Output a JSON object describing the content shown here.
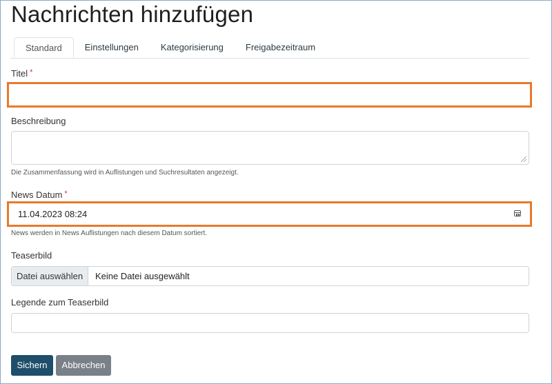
{
  "page": {
    "title": "Nachrichten hinzufügen"
  },
  "tabs": [
    {
      "label": "Standard",
      "active": true
    },
    {
      "label": "Einstellungen",
      "active": false
    },
    {
      "label": "Kategorisierung",
      "active": false
    },
    {
      "label": "Freigabezeitraum",
      "active": false
    }
  ],
  "form": {
    "title": {
      "label": "Titel",
      "required_mark": "*",
      "value": ""
    },
    "description": {
      "label": "Beschreibung",
      "value": "",
      "help": "Die Zusammenfassung wird in Auflistungen und Suchresultaten angezeigt."
    },
    "news_date": {
      "label": "News Datum",
      "required_mark": "*",
      "value": "11.04.2023 08:24",
      "help": "News werden in News Auflistungen nach diesem Datum sortiert.",
      "icon": "calendar-icon"
    },
    "teaser_image": {
      "label": "Teaserbild",
      "button_label": "Datei auswählen",
      "status": "Keine Datei ausgewählt"
    },
    "teaser_caption": {
      "label": "Legende zum Teaserbild",
      "value": ""
    }
  },
  "actions": {
    "save_label": "Sichern",
    "cancel_label": "Abbrechen"
  },
  "colors": {
    "highlight": "#e8792b",
    "primary_button": "#1e4e6a",
    "secondary_button": "#7a8088",
    "required": "#c0392b"
  }
}
